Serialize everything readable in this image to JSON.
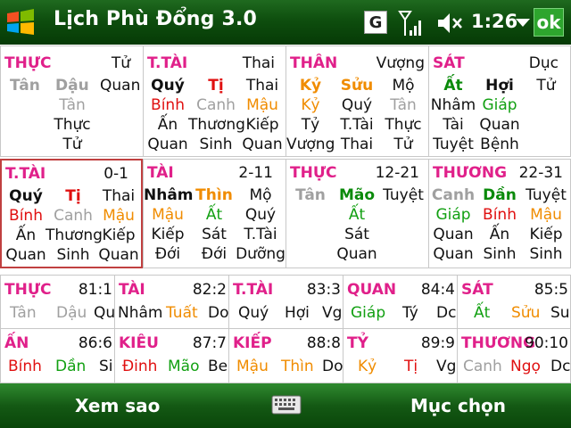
{
  "window": {
    "title": "Lịch Phù Đổng 3.0",
    "clock": "1:26",
    "ok_label": "ok",
    "g_label": "G",
    "icons": [
      "windows-logo-icon",
      "g-icon",
      "signal-icon",
      "volume-mute-icon",
      "dropdown-arrow-icon",
      "keyboard-icon"
    ]
  },
  "colors": {
    "header": "#e0208a",
    "accent_red": "#e01010",
    "accent_orange": "#f08c00",
    "accent_green": "#12a012",
    "muted": "#a0a0a0",
    "bar_green": "#145914"
  },
  "grid": {
    "r1": [
      {
        "title": "THỰC",
        "right": "Tử",
        "row1": [
          "Tân",
          "Dậu",
          "Quan"
        ],
        "lines": [
          "Tân",
          "Thực",
          "Tử"
        ]
      },
      {
        "title": "T.TÀI",
        "right": "Thai",
        "row1": [
          "Quý",
          "Tị",
          "Thai"
        ],
        "row2": [
          "Bính",
          "Canh",
          "Mậu"
        ],
        "row3": [
          "Ấn",
          "Thương",
          "Kiếp"
        ],
        "row4": [
          "Quan",
          "Sinh",
          "Quan"
        ]
      },
      {
        "title": "THÂN",
        "right": "Vượng",
        "row1": [
          "Kỷ",
          "Sửu",
          "Mộ"
        ],
        "row2": [
          "Kỷ",
          "Quý",
          "Tân"
        ],
        "row3": [
          "Tỷ",
          "T.Tài",
          "Thực"
        ],
        "row4": [
          "Vượng",
          "Thai",
          "Tử"
        ]
      },
      {
        "title": "SÁT",
        "right": "Dục",
        "row1": [
          "Ất",
          "Hợi",
          "Tử"
        ],
        "row2": [
          "Nhâm",
          "Giáp"
        ],
        "row3": [
          "Tài",
          "Quan"
        ],
        "row4": [
          "Tuyệt",
          "Bệnh"
        ]
      }
    ],
    "r2": [
      {
        "title": "T.TÀI",
        "right": "0-1",
        "row1": [
          "Quý",
          "Tị",
          "Thai"
        ],
        "row2": [
          "Bính",
          "Canh",
          "Mậu"
        ],
        "row3": [
          "Ấn",
          "Thương",
          "Kiếp"
        ],
        "row4": [
          "Quan",
          "Sinh",
          "Quan"
        ]
      },
      {
        "title": "TÀI",
        "right": "2-11",
        "row1": [
          "Nhâm",
          "Thìn",
          "Mộ"
        ],
        "row2": [
          "Mậu",
          "Ất",
          "Quý"
        ],
        "row3": [
          "Kiếp",
          "Sát",
          "T.Tài"
        ],
        "row4": [
          "Đới",
          "Đới",
          "Dưỡng"
        ]
      },
      {
        "title": "THỰC",
        "right": "12-21",
        "row1": [
          "Tân",
          "Mão",
          "Tuyệt"
        ],
        "lines": [
          "Ất",
          "Sát",
          "Quan"
        ]
      },
      {
        "title": "THƯƠNG",
        "right": "22-31",
        "row1": [
          "Canh",
          "Dần",
          "Tuyệt"
        ],
        "row2": [
          "Giáp",
          "Bính",
          "Mậu"
        ],
        "row3": [
          "Quan",
          "Ấn",
          "Kiếp"
        ],
        "row4": [
          "Quan",
          "Sinh",
          "Sinh"
        ]
      }
    ],
    "r3": [
      {
        "title": "THỰC",
        "right": "81:1",
        "vals": [
          "Tân",
          "Dậu",
          "Qu"
        ]
      },
      {
        "title": "TÀI",
        "right": "82:2",
        "vals": [
          "Nhâm",
          "Tuất",
          "Do"
        ]
      },
      {
        "title": "T.TÀI",
        "right": "83:3",
        "vals": [
          "Quý",
          "Hợi",
          "Vg"
        ]
      },
      {
        "title": "QUAN",
        "right": "84:4",
        "vals": [
          "Giáp",
          "Tý",
          "Dc"
        ]
      },
      {
        "title": "SÁT",
        "right": "85:5",
        "vals": [
          "Ất",
          "Sửu",
          "Su"
        ]
      }
    ],
    "r4": [
      {
        "title": "ẤN",
        "right": "86:6",
        "vals": [
          "Bính",
          "Dần",
          "Si"
        ]
      },
      {
        "title": "KIÊU",
        "right": "87:7",
        "vals": [
          "Đinh",
          "Mão",
          "Be"
        ]
      },
      {
        "title": "KIẾP",
        "right": "88:8",
        "vals": [
          "Mậu",
          "Thìn",
          "Do"
        ]
      },
      {
        "title": "TỶ",
        "right": "89:9",
        "vals": [
          "Kỷ",
          "Tị",
          "Vg"
        ]
      },
      {
        "title": "THƯƠNG",
        "right": "90:10",
        "vals": [
          "Canh",
          "Ngọ",
          "Dc"
        ]
      }
    ]
  },
  "menu": {
    "left": "Xem sao",
    "right": "Mục chọn"
  }
}
